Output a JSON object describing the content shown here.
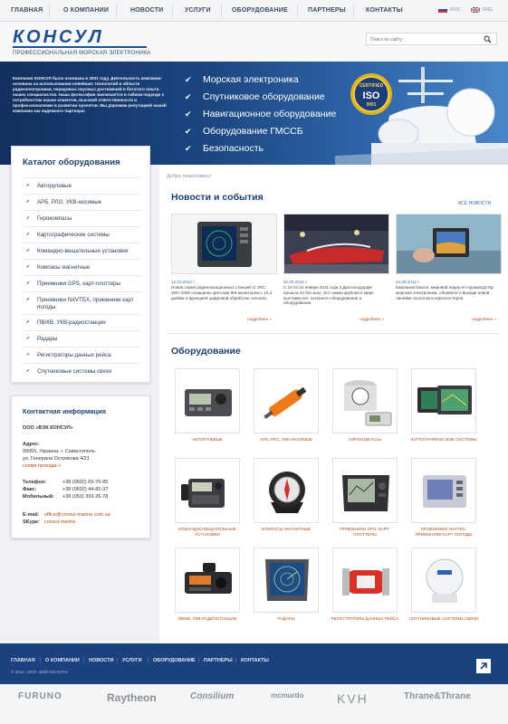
{
  "top_nav": {
    "items": [
      "ГЛАВНАЯ",
      "О КОМПАНИИ",
      "НОВОСТИ",
      "УСЛУГИ",
      "ОБОРУДОВАНИЕ",
      "ПАРТНЕРЫ",
      "КОНТАКТЫ"
    ],
    "lang_ru": "RUS",
    "lang_en": "ENG"
  },
  "header": {
    "logo": "КОНСУЛ",
    "tagline": "ПРОФЕССИОНАЛЬНАЯ МОРСКАЯ ЭЛЕКТРОНИКА",
    "search_placeholder": "Поиск по сайту"
  },
  "banner": {
    "intro": "Компания КОНСУЛ была основана в 2001 году. Деятельность компании основана на использовании новейших технологий в области радиоэлектроники, передовых научных достижений и богатого опыта наших специалистов. Наша философия заключается в гибком подходе к потребностям наших клиентов, высокой ответственности и профессионализме в развитии проектов. Мы дорожим репутацией нашей компании как надежного партнера!",
    "features": [
      "Морская электроника",
      "Спутниковое оборудование",
      "Навигационное оборудование",
      "Оборудование ГМССБ",
      "Безопасность"
    ],
    "seal_text": "ISO",
    "seal_top": "CERTIFIED",
    "seal_num": "9001"
  },
  "catalog": {
    "title": "Каталог оборудования",
    "items": [
      "Авторулевые",
      "АРБ, РЛО, УКВ-носимые",
      "Гирокомпасы",
      "Картографические системы",
      "Командно-вещательные установки",
      "Компасы магнитные",
      "Приемники GPS, карт-плоттеры",
      "Приемники NAVTEX, приемники карт погоды",
      "ПВ/КВ, УКВ-радиостанции",
      "Радары",
      "Регистраторы данных рейса",
      "Спутниковые системы связи"
    ]
  },
  "contacts": {
    "title": "Контактная информация",
    "company": "ООО «ВЭК КОНСУЛ»",
    "address_label": "Адрес:",
    "address_1": "99055, Украина, г. Севастополь",
    "address_2": "ул. Генерала Острякова 4/21",
    "map_link": "схема проезда »",
    "phone_label": "Телефон:",
    "phone": "+38 (0692) 65-76-85",
    "fax_label": "Факс:",
    "fax": "+38 (0692) 44-82-37",
    "mobile_label": "Мобильный:",
    "mobile": "+38 (050) 393-26-78",
    "email_label": "E-mail:",
    "email": "office@consul-marine.com.ua",
    "skype_label": "SKype:",
    "skype": "consul-marine"
  },
  "main": {
    "breadcrumb": "Добро пожаловать!",
    "news_title": "Новости и события",
    "all_news": "ВСЕ НОВОСТИ",
    "news": [
      {
        "date": "12.10.2012 г.",
        "text": "Новая серия радиолокационных станций от JRC. JMA-3300 оснащены цветным ЖК-монитором с 10,4 дюйма и функцией цифровой обработки сигнала.",
        "more": "подробнее »"
      },
      {
        "date": "02.09.2012 г.",
        "text": "С 23 по 31 января 2011 года в Дюссельдорфе прошла 42 бот-шоу. Это самая крупная в мире выставка яхт, катерного оборудования и оборудования.",
        "more": "подробнее »"
      },
      {
        "date": "24.08.2012 г.",
        "text": "Компания Navico, мировой лидер по производству морской электроники, объявила о выходе новой линейки эхолотов и картплоттеров",
        "more": "подробнее »"
      }
    ],
    "equipment_title": "Оборудование",
    "equipment": [
      "АВТОРУЛЕВЫЕ",
      "АРБ, РЛО, УКВ-НОСИМЫЕ",
      "ГИРОКОМПАСЫ",
      "КАРТОГРАФИЧЕСКИЕ СИСТЕМЫ",
      "КОМАНДНО-ВЕЩАТЕЛЬНЫЕ УСТАНОВКИ",
      "КОМПАСЫ МАГНИТНЫЕ",
      "ПРИЕМНИКИ GPS, КАРТ-ПЛОТТЕРЫ",
      "ПРИЕМНИКИ NAVTEX, ПРИЕМНИКИ КАРТ ПОГОДЫ",
      "ПВ/КВ, УКВ-РАДИОСТАНЦИИ",
      "РАДАРЫ",
      "РЕГИСТРАТОРЫ ДАННЫХ РЕЙСА",
      "СПУТНИКОВЫЕ СИСТЕМЫ СВЯЗИ"
    ]
  },
  "footer": {
    "links": [
      "ГЛАВНАЯ",
      "О КОМПАНИИ",
      "НОВОСТИ",
      "УСЛУГИ",
      "ОБОРУДОВАНИЕ",
      "ПАРТНЕРЫ",
      "КОНТАКТЫ"
    ],
    "copyright": "© 2012, ООО «ВЭК КОНСУЛ»"
  },
  "brands": [
    "FURUNO",
    "Raytheon",
    "Consilium",
    "mcmurdo",
    "KVH",
    "Thrane&Thrane"
  ],
  "colors": {
    "brand_blue": "#1f4f8e",
    "link_orange": "#b04a14",
    "footer_blue": "#1b427e"
  }
}
